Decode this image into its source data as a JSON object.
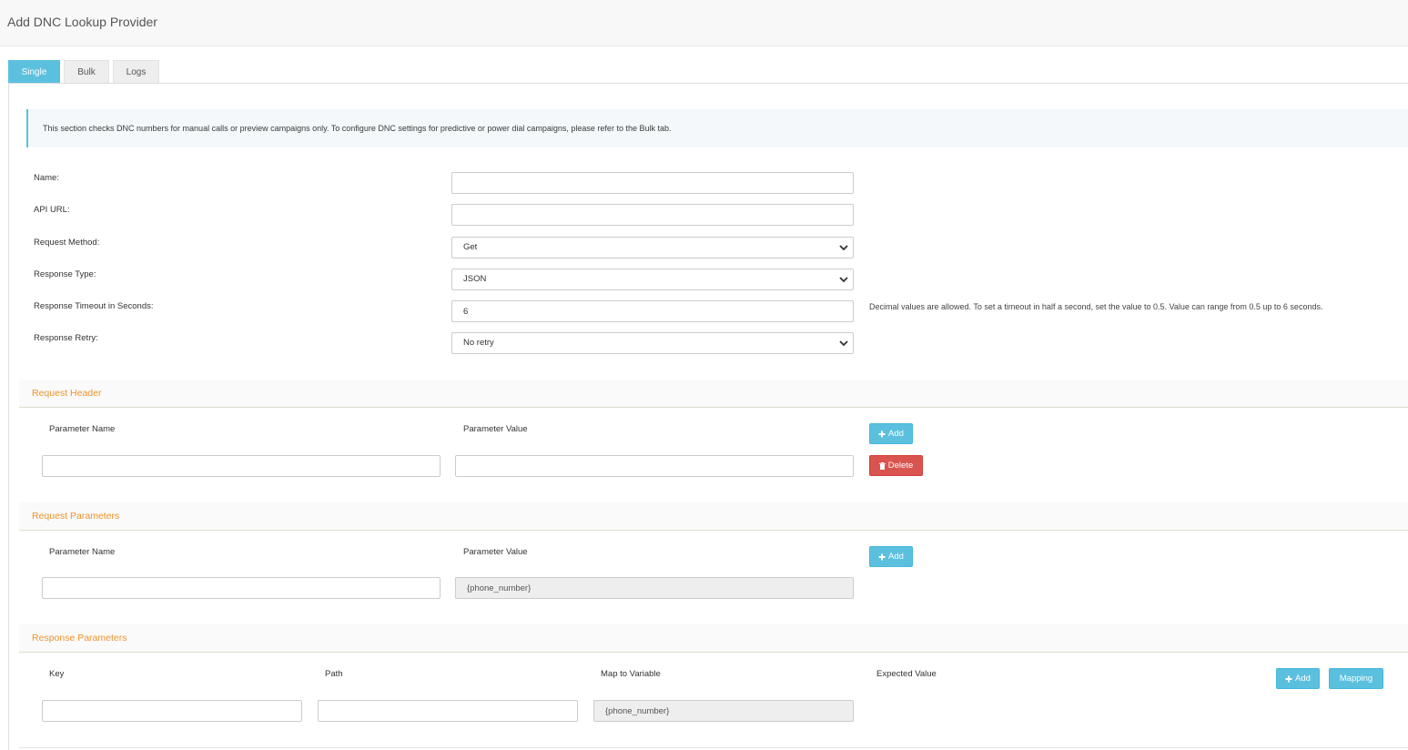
{
  "page": {
    "title": "Add DNC Lookup Provider"
  },
  "tabs": [
    {
      "label": "Single",
      "active": true
    },
    {
      "label": "Bulk",
      "active": false
    },
    {
      "label": "Logs",
      "active": false
    }
  ],
  "info": {
    "text": "This section checks DNC numbers for manual calls or preview campaigns only. To configure DNC settings for predictive or power dial campaigns, please refer to the Bulk tab."
  },
  "form": {
    "name": {
      "label": "Name:",
      "value": ""
    },
    "api_url": {
      "label": "API URL:",
      "value": ""
    },
    "request_method": {
      "label": "Request Method:",
      "value": "Get"
    },
    "response_type": {
      "label": "Response Type:",
      "value": "JSON"
    },
    "response_timeout": {
      "label": "Response Timeout in Seconds:",
      "value": "6",
      "help": "Decimal values are allowed. To set a timeout in half a second, set the value to 0.5. Value can range from 0.5 up to 6 seconds."
    },
    "response_retry": {
      "label": "Response Retry:",
      "value": "No retry"
    }
  },
  "request_header": {
    "title": "Request Header",
    "col_name": "Parameter Name",
    "col_value": "Parameter Value",
    "add_label": "Add",
    "delete_label": "Delete",
    "row": {
      "name": "",
      "value": ""
    }
  },
  "request_parameters": {
    "title": "Request Parameters",
    "col_name": "Parameter Name",
    "col_value": "Parameter Value",
    "add_label": "Add",
    "row": {
      "name": "",
      "value": "{phone_number}"
    }
  },
  "response_parameters": {
    "title": "Response Parameters",
    "col_key": "Key",
    "col_path": "Path",
    "col_map": "Map to Variable",
    "col_expected": "Expected Value",
    "add_label": "Add",
    "mapping_label": "Mapping",
    "row": {
      "key": "",
      "path": "",
      "map": "{phone_number}"
    }
  },
  "colors": {
    "accent": "#5bc0de",
    "danger": "#d9534f",
    "section_title": "#f0932b"
  }
}
